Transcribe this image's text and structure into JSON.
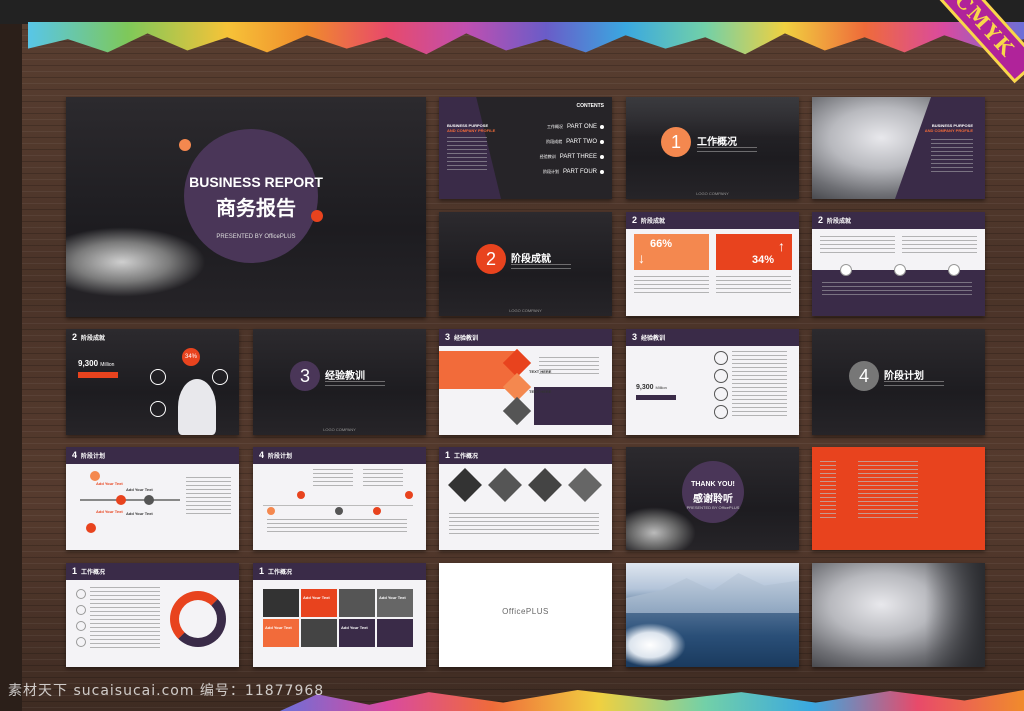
{
  "brand": {
    "cmyk": "CMYK"
  },
  "watermark": "素材天下 sucaisucai.com   编号：11877968",
  "cover": {
    "title": "BUSINESS REPORT",
    "title_cn": "商务报告",
    "presented": "PRESENTED BY OfficePLUS"
  },
  "contents": {
    "heading": "CONTENTS",
    "left_title1": "BUSINESS PURPOSE",
    "left_title2": "AND COMPANY PROFILE",
    "items": [
      {
        "cn": "工作概况",
        "en": "PART ONE"
      },
      {
        "cn": "阶段成就",
        "en": "PART TWO"
      },
      {
        "cn": "经验教训",
        "en": "PART THREE"
      },
      {
        "cn": "阶段计划",
        "en": "PART FOUR"
      }
    ]
  },
  "section1": {
    "num": "1",
    "title": "工作概况",
    "logo": "LOGO COMPANY"
  },
  "profile": {
    "title1": "BUSINESS PURPOSE",
    "title2": "AND COMPANY PROFILE"
  },
  "section2": {
    "num": "2",
    "title": "阶段成就",
    "logo": "LOGO COMPANY"
  },
  "s2a": {
    "num": "2",
    "title": "阶段成就",
    "pct1": "66%",
    "pct2": "34%"
  },
  "s2b": {
    "num": "2",
    "title": "阶段成就"
  },
  "s2c": {
    "num": "2",
    "title": "阶段成就",
    "value": "9,300",
    "unit": "Million",
    "pct": "34%"
  },
  "section3": {
    "num": "3",
    "title": "经验教训",
    "logo": "LOGO COMPANY"
  },
  "s3a": {
    "num": "3",
    "title": "经验教训",
    "labels": [
      "TEXT HERE",
      "TEXT HERE",
      "TEXT HERE",
      "TEXT HERE"
    ]
  },
  "s3b": {
    "num": "3",
    "title": "经验教训",
    "value": "9,300",
    "unit": "Million"
  },
  "section4": {
    "num": "4",
    "title": "阶段计划"
  },
  "s4a": {
    "num": "4",
    "title": "阶段计划",
    "labels": [
      "Add Your Text",
      "Add Your Text",
      "Add Your Text",
      "Add Your Text"
    ]
  },
  "s4b": {
    "num": "4",
    "title": "阶段计划"
  },
  "s1a": {
    "num": "1",
    "title": "工作概况"
  },
  "thanks": {
    "en": "THANK YOU!",
    "cn": "感谢聆听",
    "presented": "PRESENTED BY OfficePLUS"
  },
  "s1b": {
    "num": "1",
    "title": "工作概况"
  },
  "s1c": {
    "num": "1",
    "title": "工作概况",
    "labels": [
      "Add Your Text",
      "Add Your Text",
      "Add Your Text",
      "Add Your Text"
    ]
  },
  "office": {
    "brand": "OfficePLUS"
  },
  "colors": {
    "accent": "#f26b3a",
    "purple": "#3a2b48",
    "red": "#e8431e"
  }
}
